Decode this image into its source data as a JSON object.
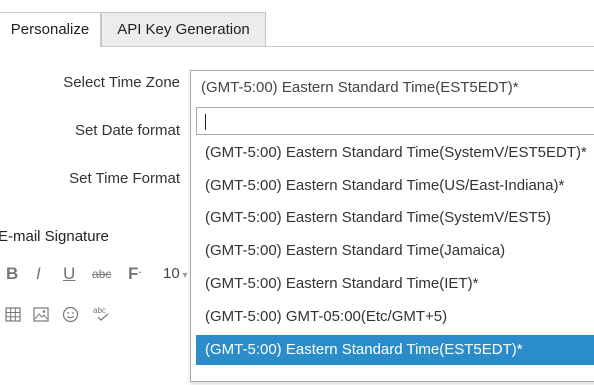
{
  "tabs": {
    "personalize": "Personalize",
    "api_key": "API Key Generation"
  },
  "form": {
    "time_zone_label": "Select Time Zone",
    "date_format_label": "Set Date format",
    "time_format_label": "Set Time Format"
  },
  "signature": {
    "title": "E-mail Signature",
    "font_size": "10",
    "toolbar_icons": [
      "bold-icon",
      "italic-icon",
      "underline-icon",
      "strikethrough-icon",
      "font-icon",
      "font-size",
      "table-icon",
      "image-icon",
      "emoji-icon",
      "spellcheck-icon"
    ]
  },
  "timezone_dropdown": {
    "selected": "(GMT-5:00) Eastern Standard Time(EST5EDT)*",
    "search_value": "",
    "options": [
      "(GMT-5:00) Eastern Standard Time(SystemV/EST5EDT)*",
      "(GMT-5:00) Eastern Standard Time(US/East-Indiana)*",
      "(GMT-5:00) Eastern Standard Time(SystemV/EST5)",
      "(GMT-5:00) Eastern Standard Time(Jamaica)",
      "(GMT-5:00) Eastern Standard Time(IET)*",
      "(GMT-5:00) GMT-05:00(Etc/GMT+5)",
      "(GMT-5:00) Eastern Standard Time(EST5EDT)*"
    ],
    "highlight_color": "#2a8dc9"
  }
}
